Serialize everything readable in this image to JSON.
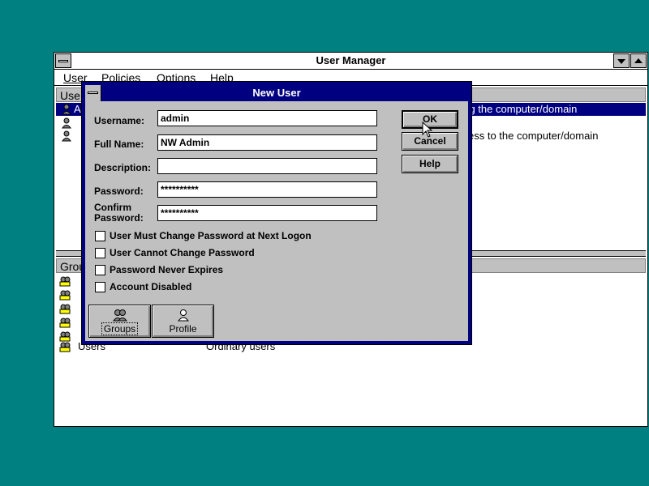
{
  "main_window": {
    "title": "User Manager",
    "menu": [
      "User",
      "Policies",
      "Options",
      "Help"
    ],
    "users_header": "Use",
    "users": [
      {
        "name_fragment": "A",
        "description_fragment": "ring the computer/domain",
        "selected": true
      },
      {
        "name_fragment": "",
        "description_fragment": "",
        "selected": false
      },
      {
        "name_fragment": "",
        "description_fragment": "ess to the computer/domain",
        "selected": false
      }
    ],
    "groups_header": "Group",
    "groups": [
      {
        "name": "",
        "description": ""
      },
      {
        "name": "",
        "description": ""
      },
      {
        "name": "",
        "description": ""
      },
      {
        "name": "",
        "description": ""
      },
      {
        "name": "",
        "description": ""
      },
      {
        "name": "Users",
        "description": "Ordinary users"
      }
    ]
  },
  "dialog": {
    "title": "New User",
    "fields": {
      "username": {
        "label": "Username:",
        "value": "admin"
      },
      "full_name": {
        "label": "Full Name:",
        "value": "NW Admin"
      },
      "description": {
        "label": "Description:",
        "value": ""
      },
      "password": {
        "label": "Password:",
        "value": "**********"
      },
      "confirm": {
        "label_line1": "Confirm",
        "label_line2": "Password:",
        "value": "**********"
      }
    },
    "checkboxes": [
      {
        "label": "User Must Change Password at Next Logon",
        "checked": false
      },
      {
        "label": "User Cannot Change Password",
        "checked": false
      },
      {
        "label": "Password Never Expires",
        "checked": false
      },
      {
        "label": "Account Disabled",
        "checked": false
      }
    ],
    "buttons": {
      "ok": "OK",
      "cancel": "Cancel",
      "help": "Help",
      "groups": "Groups",
      "profile": "Profile"
    }
  },
  "colors": {
    "desktop": "#008080",
    "title_active": "#000080",
    "selection": "#000080",
    "face": "#c0c0c0"
  },
  "icons": [
    "system-menu-icon",
    "scroll-down-arrow-icon",
    "scroll-up-arrow-icon",
    "user-icon",
    "group-icon",
    "profile-icon",
    "mouse-pointer-icon"
  ]
}
